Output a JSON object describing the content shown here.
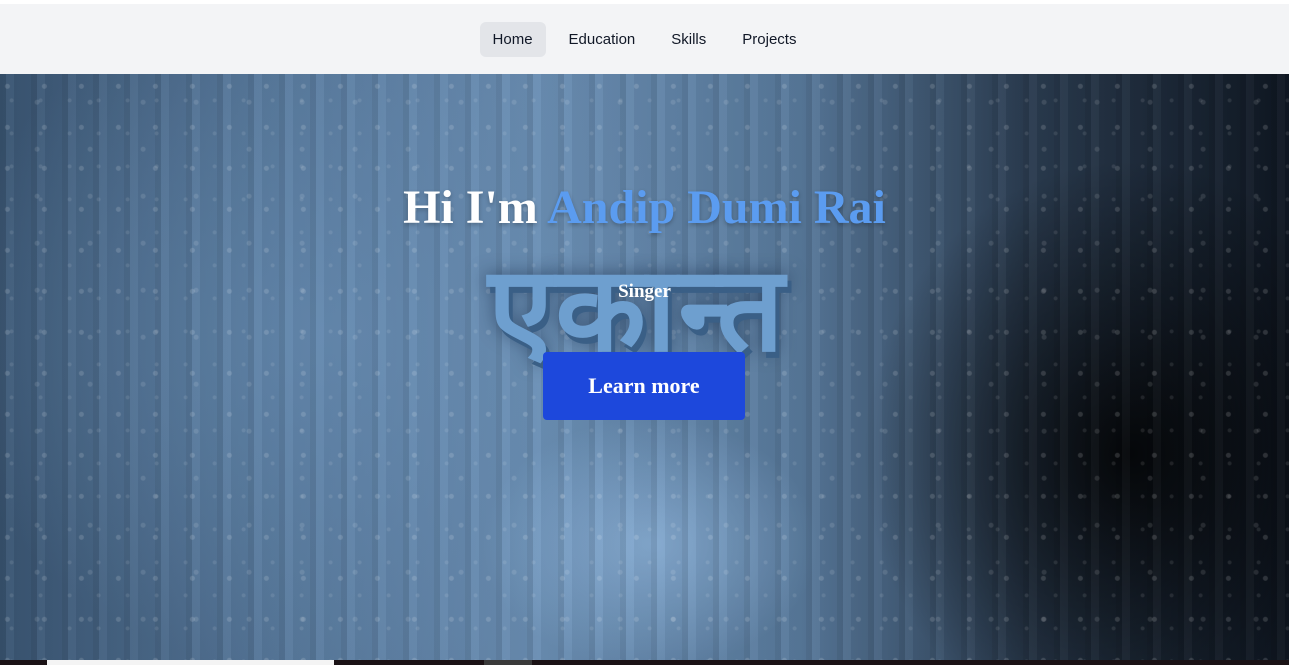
{
  "nav": {
    "items": [
      {
        "label": "Home",
        "active": true
      },
      {
        "label": "Education",
        "active": false
      },
      {
        "label": "Skills",
        "active": false
      },
      {
        "label": "Projects",
        "active": false
      }
    ]
  },
  "hero": {
    "greeting": "Hi I'm",
    "name": "Andip Dumi Rai",
    "subtitle": "Singer",
    "background_word": "एकान्त",
    "cta_label": "Learn more"
  },
  "colors": {
    "accent_name": "#5b9cf0",
    "cta_background": "#1d48dc",
    "nav_background": "#f3f4f6"
  }
}
